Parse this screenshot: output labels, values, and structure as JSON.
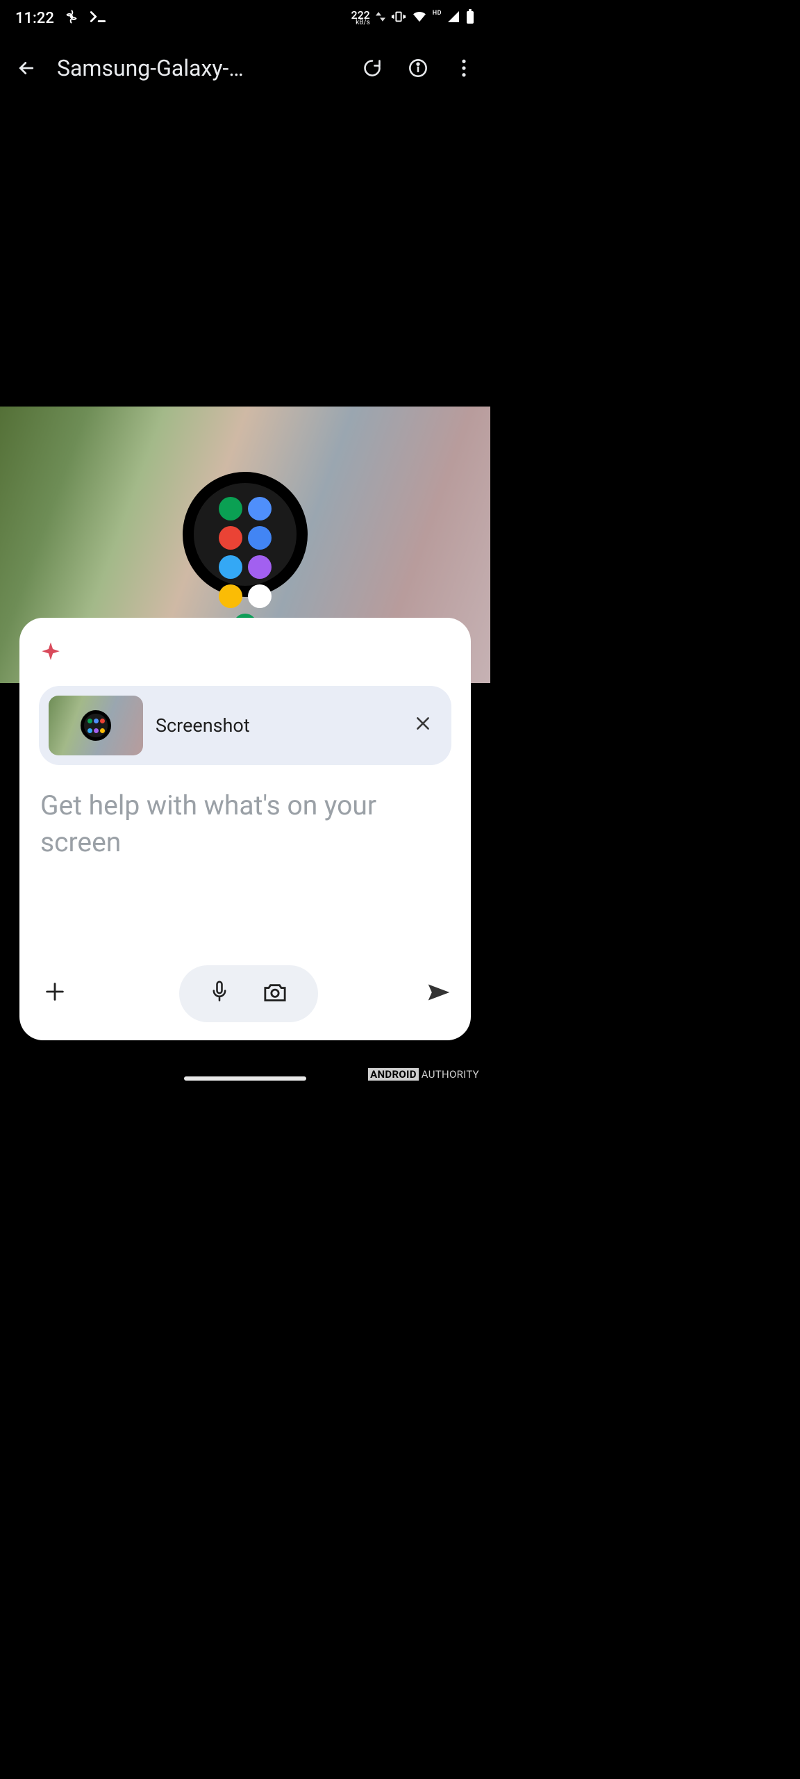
{
  "status": {
    "time": "11:22",
    "net_speed_value": "222",
    "net_speed_unit": "kB/s",
    "hd_label": "HD"
  },
  "appbar": {
    "title": "Samsung-Galaxy-…"
  },
  "overlay": {
    "chip_label": "Screenshot",
    "placeholder": "Get help with what's on your screen"
  },
  "watermark": {
    "brand_boxed": "ANDROID",
    "brand_rest": "AUTHORITY"
  },
  "watch_colors": [
    "#0aa053",
    "#4f8ffb",
    "#ea4335",
    "#4285f4",
    "#34a8f5",
    "#a260f0",
    "#fbbc05",
    "#ffffff",
    "#0f9d58"
  ],
  "mini_colors": [
    "#0aa053",
    "#4f8ffb",
    "#ea4335",
    "#34a8f5",
    "#a260f0",
    "#fbbc05"
  ]
}
